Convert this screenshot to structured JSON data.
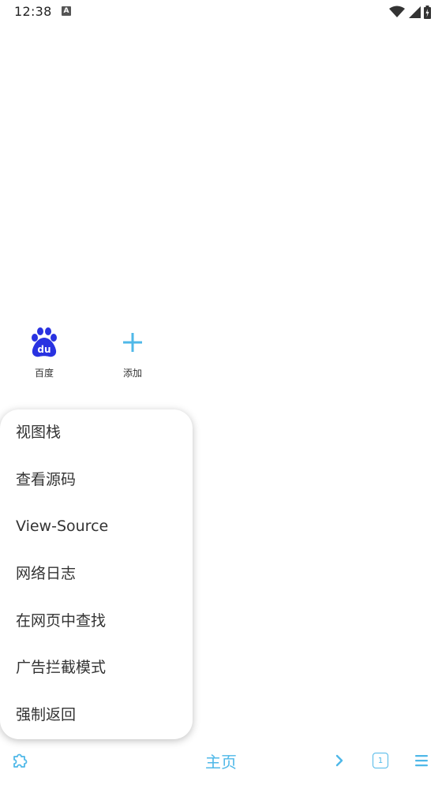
{
  "status_bar": {
    "time": "12:38",
    "notification_icon": "a-icon",
    "wifi_icon": "wifi-icon",
    "signal_icon": "signal-icon",
    "battery_icon": "battery-icon"
  },
  "speed_dial": {
    "items": [
      {
        "label": "百度",
        "icon": "baidu-paw-icon"
      },
      {
        "label": "添加",
        "icon": "plus-icon"
      }
    ]
  },
  "menu": {
    "items": [
      {
        "label": "视图栈"
      },
      {
        "label": "查看源码"
      },
      {
        "label": "View-Source"
      },
      {
        "label": "网络日志"
      },
      {
        "label": "在网页中查找"
      },
      {
        "label": "广告拦截模式"
      },
      {
        "label": "强制返回"
      }
    ]
  },
  "bottom_bar": {
    "extensions_icon": "puzzle-icon",
    "home_label": "主页",
    "forward_icon": "chevron-right-icon",
    "tab_count": "1",
    "menu_icon": "hamburger-icon"
  },
  "colors": {
    "accent": "#4fb8e8",
    "baidu_blue": "#2932e1",
    "text": "#333333"
  }
}
